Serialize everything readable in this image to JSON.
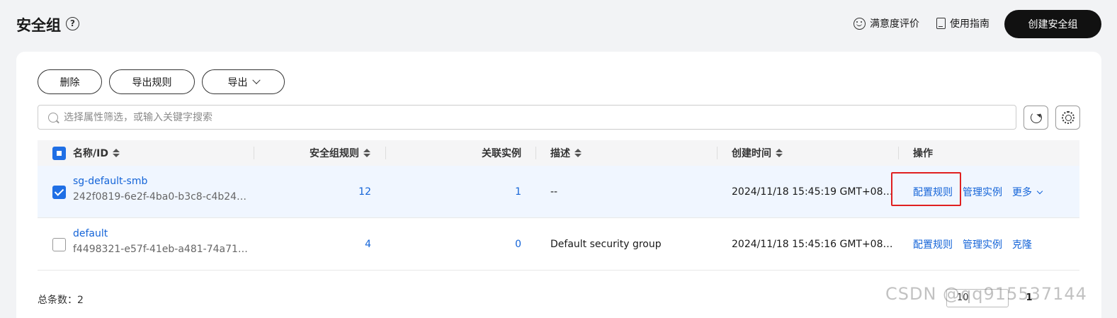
{
  "header": {
    "title": "安全组",
    "help_icon": "question-circle-icon",
    "feedback_label": "满意度评价",
    "guide_label": "使用指南",
    "create_label": "创建安全组"
  },
  "toolbar": {
    "delete_label": "删除",
    "export_rules_label": "导出规则",
    "export_label": "导出",
    "search_placeholder": "选择属性筛选，或输入关键字搜索"
  },
  "table": {
    "columns": {
      "name": "名称/ID",
      "rules": "安全组规则",
      "instances": "关联实例",
      "description": "描述",
      "created": "创建时间",
      "operations": "操作"
    },
    "rows": [
      {
        "name": "sg-default-smb",
        "id": "242f0819-6e2f-4ba0-b3c8-c4b24…",
        "rules": "12",
        "instances": "1",
        "description": "--",
        "created": "2024/11/18 15:45:19 GMT+08…",
        "op1": "配置规则",
        "op2": "管理实例",
        "op3": "更多",
        "selected": true
      },
      {
        "name": "default",
        "id": "f4498321-e57f-41eb-a481-74a71…",
        "rules": "4",
        "instances": "0",
        "description": "Default security group",
        "created": "2024/11/18 15:45:16 GMT+08…",
        "op1": "配置规则",
        "op2": "管理实例",
        "op3": "克隆",
        "selected": false
      }
    ]
  },
  "footer": {
    "total_label": "总条数：2",
    "page_size": "10",
    "current_page": "1"
  },
  "watermark": "CSDN @qq915537144",
  "colors": {
    "accent": "#1f6fe5",
    "link": "#1464d8",
    "highlight": "#e02020",
    "primary_button": "#111111"
  }
}
